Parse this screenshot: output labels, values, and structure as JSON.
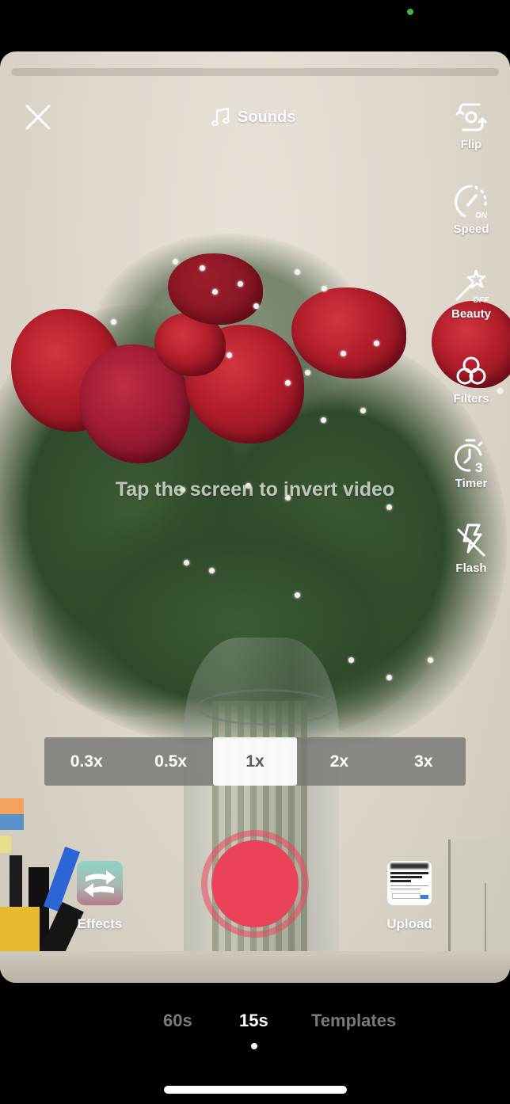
{
  "status_bar": {
    "privacy_indicator_color": "#3fb54a"
  },
  "top_bar": {
    "close_icon": "close-x-icon",
    "sounds_label": "Sounds",
    "sounds_icon": "music-note-icon"
  },
  "recording_progress": {
    "fraction_recorded": 0
  },
  "side_tools": [
    {
      "id": "flip",
      "label": "Flip",
      "icon": "camera-flip-icon"
    },
    {
      "id": "speed",
      "label": "Speed",
      "icon": "speedometer-icon",
      "badge": "ON"
    },
    {
      "id": "beauty",
      "label": "Beauty",
      "icon": "magic-wand-icon",
      "badge": "OFF"
    },
    {
      "id": "filters",
      "label": "Filters",
      "icon": "filters-circles-icon"
    },
    {
      "id": "timer",
      "label": "Timer",
      "icon": "stopwatch-icon",
      "badge": "3"
    },
    {
      "id": "flash",
      "label": "Flash",
      "icon": "flash-off-icon"
    }
  ],
  "hint_text": "Tap the screen to invert video",
  "speed_selector": {
    "options": [
      "0.3x",
      "0.5x",
      "1x",
      "2x",
      "3x"
    ],
    "selected": "1x"
  },
  "bottom_controls": {
    "effects_label": "Effects",
    "upload_label": "Upload",
    "record_color": "#ea4359"
  },
  "mode_tabs": {
    "items": [
      "60s",
      "15s",
      "Templates"
    ],
    "selected": "15s"
  }
}
